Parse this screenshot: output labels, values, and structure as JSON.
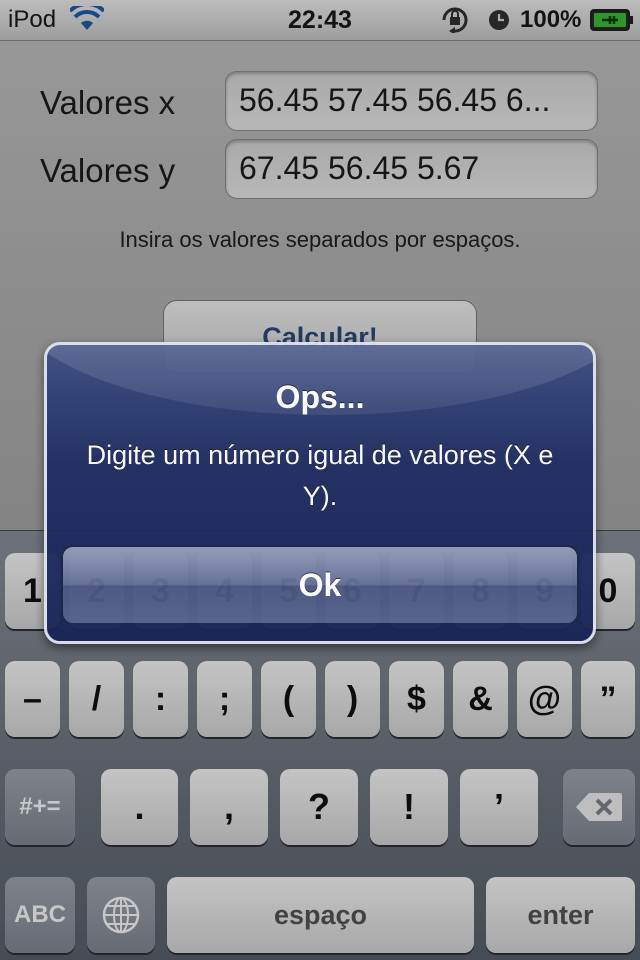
{
  "status_bar": {
    "carrier": "iPod",
    "time": "22:43",
    "battery": "100%",
    "icons": [
      "wifi-icon",
      "orientation-lock-icon",
      "alarm-icon",
      "battery-charging-icon"
    ]
  },
  "form": {
    "x_label": "Valores x",
    "x_value": "56.45 57.45 56.45 6...",
    "y_label": "Valores y",
    "y_value": "67.45 56.45 5.67",
    "hint": "Insira os valores separados por espaços.",
    "calculate_button": "Calcular!"
  },
  "alert": {
    "title": "Ops...",
    "message": "Digite um número igual de valores (X e Y).",
    "ok_button": "Ok"
  },
  "keyboard": {
    "row1": [
      "1",
      "2",
      "3",
      "4",
      "5",
      "6",
      "7",
      "8",
      "9",
      "0"
    ],
    "row2": [
      "–",
      "/",
      ":",
      ";",
      "(",
      ")",
      "$",
      "&",
      "@",
      "”"
    ],
    "row3": [
      ".",
      ",",
      "?",
      "!",
      "’"
    ],
    "symbols_key": "#+=",
    "abc_key": "ABC",
    "space_key": "espaço",
    "enter_key": "enter",
    "icons": [
      "globe-icon",
      "backspace-icon"
    ]
  },
  "colors": {
    "alert_blue": "#1f2d62",
    "button_text_blue": "#2b4e80",
    "keyboard_bg": "#6f7680"
  }
}
